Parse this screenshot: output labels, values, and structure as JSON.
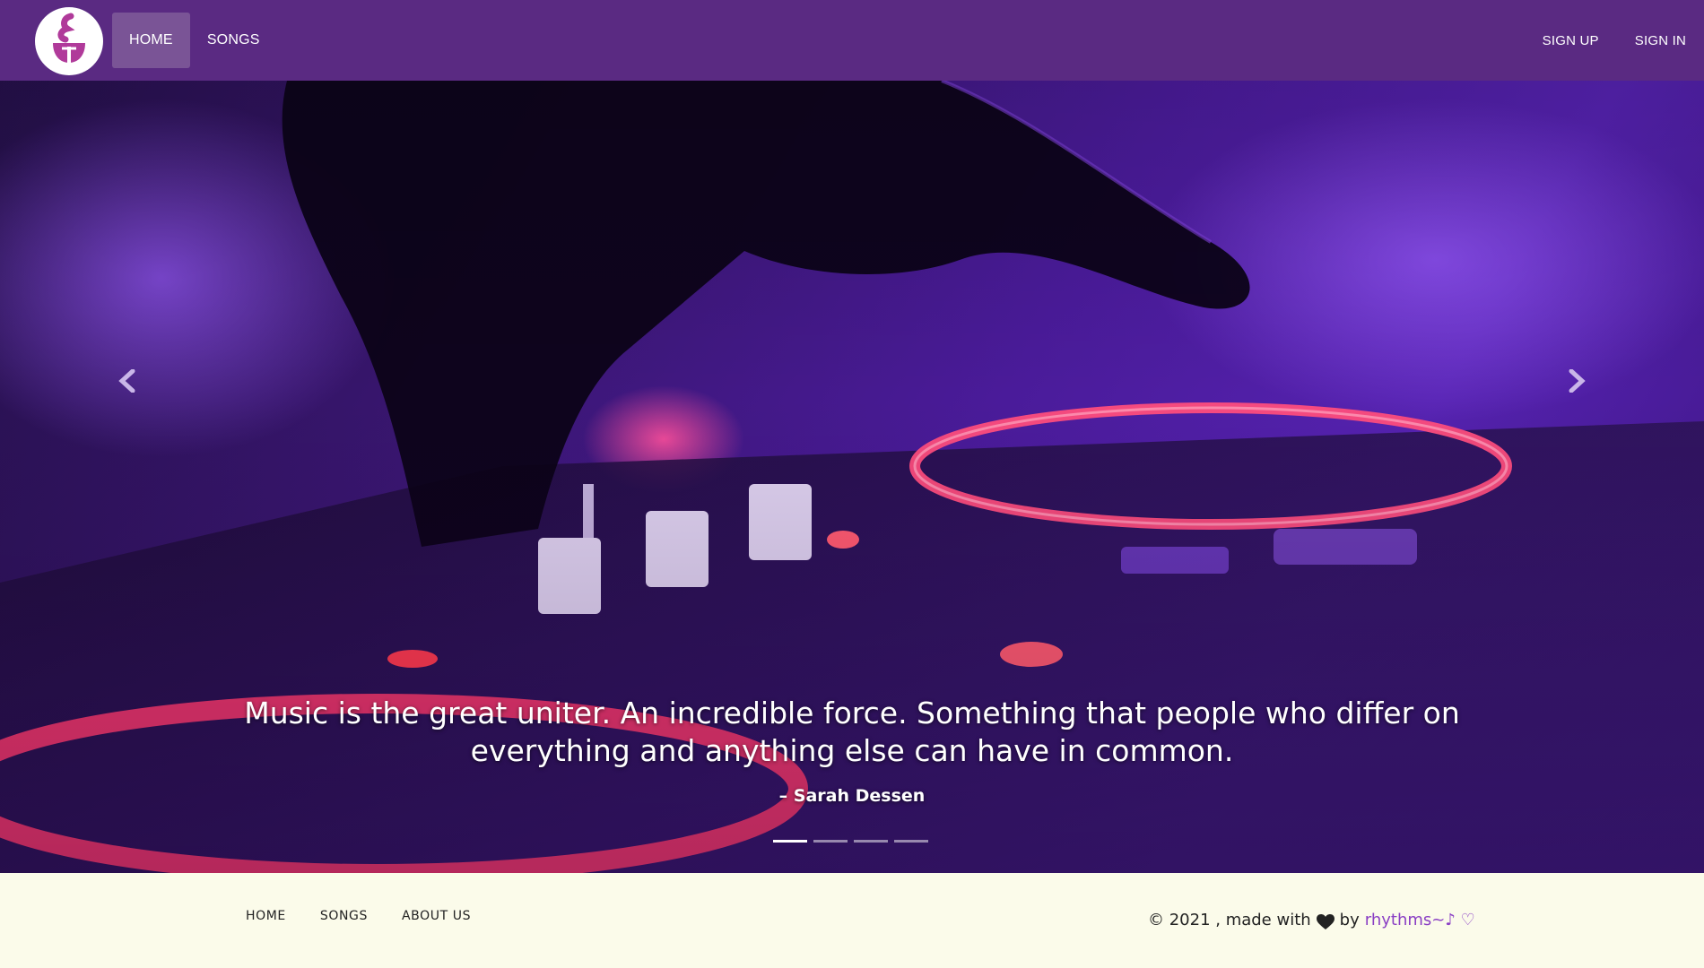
{
  "nav": {
    "logo_icon": "music-note-logo-icon",
    "left_items": [
      {
        "label": "HOME",
        "active": true
      },
      {
        "label": "SONGS",
        "active": false
      }
    ],
    "right_items": [
      {
        "label": "SIGN UP"
      },
      {
        "label": "SIGN IN"
      }
    ]
  },
  "hero": {
    "quote": "Music is the great uniter. An incredible force. Something that people who differ on everything and anything else can have in common.",
    "author": "– Sarah Dessen",
    "prev_icon": "chevron-left-icon",
    "next_icon": "chevron-right-icon",
    "slide_count": 4,
    "active_slide": 1
  },
  "footer": {
    "links": [
      "HOME",
      "SONGS",
      "ABOUT US"
    ],
    "copyright_prefix": "© 2021 , made with",
    "heart_icon": "heart-icon",
    "by_text": "by",
    "brand": "rhythms~♪ ♡"
  },
  "colors": {
    "navbar": "#5a2a82",
    "nav_active": "#7a5496",
    "footer_bg": "#fbfbea",
    "brand": "#8a3fc4",
    "logo_accent": "#b03a9a"
  }
}
